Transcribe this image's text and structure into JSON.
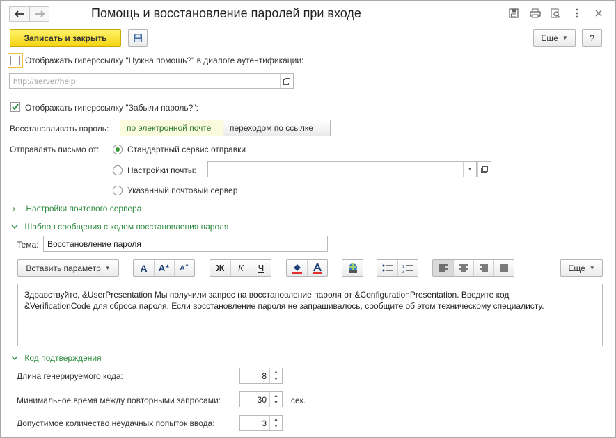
{
  "window": {
    "title": "Помощь и восстановление паролей при входе"
  },
  "toolbar": {
    "save_close_label": "Записать и закрыть",
    "more_label": "Еще",
    "help_label": "?"
  },
  "help_link": {
    "label": "Отображать гиперссылку \"Нужна помощь?\" в диалоге аутентификации:",
    "checked": false,
    "url_placeholder": "http://server/help"
  },
  "forgot_link": {
    "label": "Отображать гиперссылку \"Забыли пароль?\":",
    "checked": true
  },
  "recovery": {
    "label": "Восстанавливать пароль:",
    "options": [
      "по электронной почте",
      "переходом по ссылке"
    ],
    "selected": 0
  },
  "sender": {
    "label": "Отправлять письмо от:",
    "options": [
      "Стандартный сервис отправки",
      "Настройки почты:",
      "Указанный почтовый сервер"
    ],
    "selected": 0,
    "mail_settings_value": ""
  },
  "groups": {
    "mail_server": "Настройки почтового сервера",
    "template": "Шаблон сообщения с кодом восстановления пароля",
    "confirmation": "Код подтверждения"
  },
  "template": {
    "subject_label": "Тема:",
    "subject_value": "Восстановление пароля",
    "insert_param_label": "Вставить параметр",
    "more_label": "Еще",
    "body_line1": "Здравствуйте, &UserPresentation  Мы получили запрос на восстановление пароля от &ConfigurationPresentation.  Введите код",
    "body_line2": "&VerificationCode для сброса пароля.  Если восстановление пароля не запрашивалось, сообщите об этом техническому специалисту."
  },
  "format_buttons": {
    "bold": "Ж",
    "italic": "К",
    "underline": "Ч",
    "font_a": "A"
  },
  "confirmation": {
    "code_length_label": "Длина генерируемого кода:",
    "code_length_value": "8",
    "min_time_label": "Минимальное время между повторными запросами:",
    "min_time_value": "30",
    "min_time_unit": "сек.",
    "attempts_label": "Допустимое количество неудачных попыток ввода:",
    "attempts_value": "3"
  },
  "colors": {
    "accent_green": "#2e8a3e",
    "primary_yellow": "#f5d515"
  }
}
